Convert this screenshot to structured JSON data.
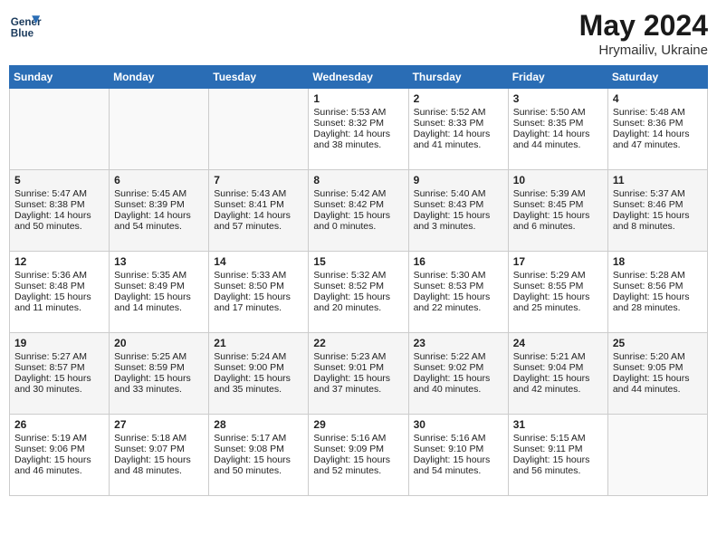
{
  "header": {
    "logo_line1": "General",
    "logo_line2": "Blue",
    "month": "May 2024",
    "location": "Hrymailiv, Ukraine"
  },
  "days_of_week": [
    "Sunday",
    "Monday",
    "Tuesday",
    "Wednesday",
    "Thursday",
    "Friday",
    "Saturday"
  ],
  "weeks": [
    [
      {
        "day": "",
        "content": ""
      },
      {
        "day": "",
        "content": ""
      },
      {
        "day": "",
        "content": ""
      },
      {
        "day": "1",
        "content": "Sunrise: 5:53 AM\nSunset: 8:32 PM\nDaylight: 14 hours\nand 38 minutes."
      },
      {
        "day": "2",
        "content": "Sunrise: 5:52 AM\nSunset: 8:33 PM\nDaylight: 14 hours\nand 41 minutes."
      },
      {
        "day": "3",
        "content": "Sunrise: 5:50 AM\nSunset: 8:35 PM\nDaylight: 14 hours\nand 44 minutes."
      },
      {
        "day": "4",
        "content": "Sunrise: 5:48 AM\nSunset: 8:36 PM\nDaylight: 14 hours\nand 47 minutes."
      }
    ],
    [
      {
        "day": "5",
        "content": "Sunrise: 5:47 AM\nSunset: 8:38 PM\nDaylight: 14 hours\nand 50 minutes."
      },
      {
        "day": "6",
        "content": "Sunrise: 5:45 AM\nSunset: 8:39 PM\nDaylight: 14 hours\nand 54 minutes."
      },
      {
        "day": "7",
        "content": "Sunrise: 5:43 AM\nSunset: 8:41 PM\nDaylight: 14 hours\nand 57 minutes."
      },
      {
        "day": "8",
        "content": "Sunrise: 5:42 AM\nSunset: 8:42 PM\nDaylight: 15 hours\nand 0 minutes."
      },
      {
        "day": "9",
        "content": "Sunrise: 5:40 AM\nSunset: 8:43 PM\nDaylight: 15 hours\nand 3 minutes."
      },
      {
        "day": "10",
        "content": "Sunrise: 5:39 AM\nSunset: 8:45 PM\nDaylight: 15 hours\nand 6 minutes."
      },
      {
        "day": "11",
        "content": "Sunrise: 5:37 AM\nSunset: 8:46 PM\nDaylight: 15 hours\nand 8 minutes."
      }
    ],
    [
      {
        "day": "12",
        "content": "Sunrise: 5:36 AM\nSunset: 8:48 PM\nDaylight: 15 hours\nand 11 minutes."
      },
      {
        "day": "13",
        "content": "Sunrise: 5:35 AM\nSunset: 8:49 PM\nDaylight: 15 hours\nand 14 minutes."
      },
      {
        "day": "14",
        "content": "Sunrise: 5:33 AM\nSunset: 8:50 PM\nDaylight: 15 hours\nand 17 minutes."
      },
      {
        "day": "15",
        "content": "Sunrise: 5:32 AM\nSunset: 8:52 PM\nDaylight: 15 hours\nand 20 minutes."
      },
      {
        "day": "16",
        "content": "Sunrise: 5:30 AM\nSunset: 8:53 PM\nDaylight: 15 hours\nand 22 minutes."
      },
      {
        "day": "17",
        "content": "Sunrise: 5:29 AM\nSunset: 8:55 PM\nDaylight: 15 hours\nand 25 minutes."
      },
      {
        "day": "18",
        "content": "Sunrise: 5:28 AM\nSunset: 8:56 PM\nDaylight: 15 hours\nand 28 minutes."
      }
    ],
    [
      {
        "day": "19",
        "content": "Sunrise: 5:27 AM\nSunset: 8:57 PM\nDaylight: 15 hours\nand 30 minutes."
      },
      {
        "day": "20",
        "content": "Sunrise: 5:25 AM\nSunset: 8:59 PM\nDaylight: 15 hours\nand 33 minutes."
      },
      {
        "day": "21",
        "content": "Sunrise: 5:24 AM\nSunset: 9:00 PM\nDaylight: 15 hours\nand 35 minutes."
      },
      {
        "day": "22",
        "content": "Sunrise: 5:23 AM\nSunset: 9:01 PM\nDaylight: 15 hours\nand 37 minutes."
      },
      {
        "day": "23",
        "content": "Sunrise: 5:22 AM\nSunset: 9:02 PM\nDaylight: 15 hours\nand 40 minutes."
      },
      {
        "day": "24",
        "content": "Sunrise: 5:21 AM\nSunset: 9:04 PM\nDaylight: 15 hours\nand 42 minutes."
      },
      {
        "day": "25",
        "content": "Sunrise: 5:20 AM\nSunset: 9:05 PM\nDaylight: 15 hours\nand 44 minutes."
      }
    ],
    [
      {
        "day": "26",
        "content": "Sunrise: 5:19 AM\nSunset: 9:06 PM\nDaylight: 15 hours\nand 46 minutes."
      },
      {
        "day": "27",
        "content": "Sunrise: 5:18 AM\nSunset: 9:07 PM\nDaylight: 15 hours\nand 48 minutes."
      },
      {
        "day": "28",
        "content": "Sunrise: 5:17 AM\nSunset: 9:08 PM\nDaylight: 15 hours\nand 50 minutes."
      },
      {
        "day": "29",
        "content": "Sunrise: 5:16 AM\nSunset: 9:09 PM\nDaylight: 15 hours\nand 52 minutes."
      },
      {
        "day": "30",
        "content": "Sunrise: 5:16 AM\nSunset: 9:10 PM\nDaylight: 15 hours\nand 54 minutes."
      },
      {
        "day": "31",
        "content": "Sunrise: 5:15 AM\nSunset: 9:11 PM\nDaylight: 15 hours\nand 56 minutes."
      },
      {
        "day": "",
        "content": ""
      }
    ]
  ]
}
